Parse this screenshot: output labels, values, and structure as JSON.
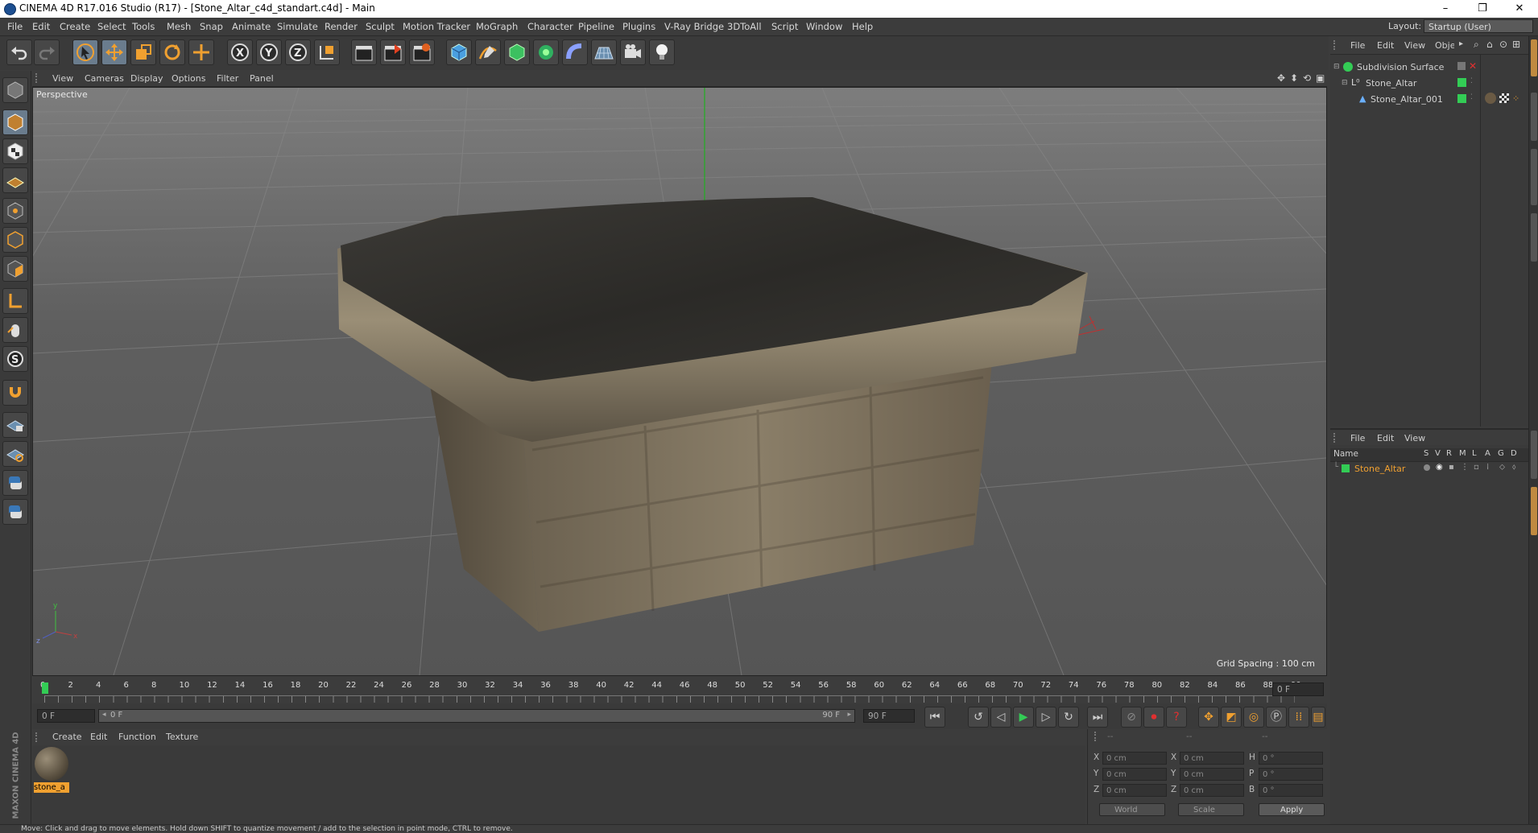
{
  "window": {
    "title": "CINEMA 4D R17.016 Studio (R17) - [Stone_Altar_c4d_standart.c4d] - Main",
    "minimize": "–",
    "restore": "❐",
    "close": "✕"
  },
  "menubar": {
    "items": [
      "File",
      "Edit",
      "Create",
      "Select",
      "Tools",
      "Mesh",
      "Snap",
      "Animate",
      "Simulate",
      "Render",
      "Sculpt",
      "Motion Tracker",
      "MoGraph",
      "Character",
      "Pipeline",
      "Plugins",
      "V-Ray Bridge",
      "3DToAll",
      "Script",
      "Window",
      "Help"
    ],
    "layout_label": "Layout:",
    "layout_value": "Startup (User)"
  },
  "viewport": {
    "menu": [
      "View",
      "Cameras",
      "Display",
      "Options",
      "Filter",
      "Panel"
    ],
    "label": "Perspective",
    "grid_spacing": "Grid Spacing : 100 cm"
  },
  "timeline": {
    "ticks": [
      "0",
      "2",
      "4",
      "6",
      "8",
      "10",
      "12",
      "14",
      "16",
      "18",
      "20",
      "22",
      "24",
      "26",
      "28",
      "30",
      "32",
      "34",
      "36",
      "38",
      "40",
      "42",
      "44",
      "46",
      "48",
      "50",
      "52",
      "54",
      "56",
      "58",
      "60",
      "62",
      "64",
      "66",
      "68",
      "70",
      "72",
      "74",
      "76",
      "78",
      "80",
      "82",
      "84",
      "86",
      "88",
      "90"
    ],
    "current_frame": "0 F",
    "start_field": "0 F",
    "range_start": "0 F",
    "range_end": "90 F",
    "end_field": "90 F"
  },
  "materials": {
    "menu": [
      "Create",
      "Edit",
      "Function",
      "Texture"
    ],
    "items": [
      {
        "name": "stone_a"
      }
    ]
  },
  "coordinates": {
    "header": [
      "--",
      "--",
      "--"
    ],
    "rows": [
      {
        "a": "X",
        "av": "0 cm",
        "b": "X",
        "bv": "0 cm",
        "c": "H",
        "cv": "0 °"
      },
      {
        "a": "Y",
        "av": "0 cm",
        "b": "Y",
        "bv": "0 cm",
        "c": "P",
        "cv": "0 °"
      },
      {
        "a": "Z",
        "av": "0 cm",
        "b": "Z",
        "bv": "0 cm",
        "c": "B",
        "cv": "0 °"
      }
    ],
    "world": "World",
    "scale": "Scale",
    "apply": "Apply"
  },
  "objects": {
    "menu": [
      "File",
      "Edit",
      "View",
      "Obje"
    ],
    "tree": [
      {
        "name": "Subdivision Surface"
      },
      {
        "name": "Stone_Altar"
      },
      {
        "name": "Stone_Altar_001"
      }
    ]
  },
  "attributes": {
    "menu": [
      "File",
      "Edit",
      "View"
    ],
    "columns": [
      "Name",
      "S",
      "V",
      "R",
      "M",
      "L",
      "A",
      "G",
      "D"
    ],
    "rows": [
      {
        "name": "Stone_Altar"
      }
    ]
  },
  "status": "Move: Click and drag to move elements. Hold down SHIFT to quantize movement / add to the selection in point mode, CTRL to remove.",
  "branding": "MAXON CINEMA 4D",
  "colors": {
    "accent_orange": "#f0a030",
    "object_green": "#33cc55",
    "ui_bg": "#3c3c3c"
  }
}
